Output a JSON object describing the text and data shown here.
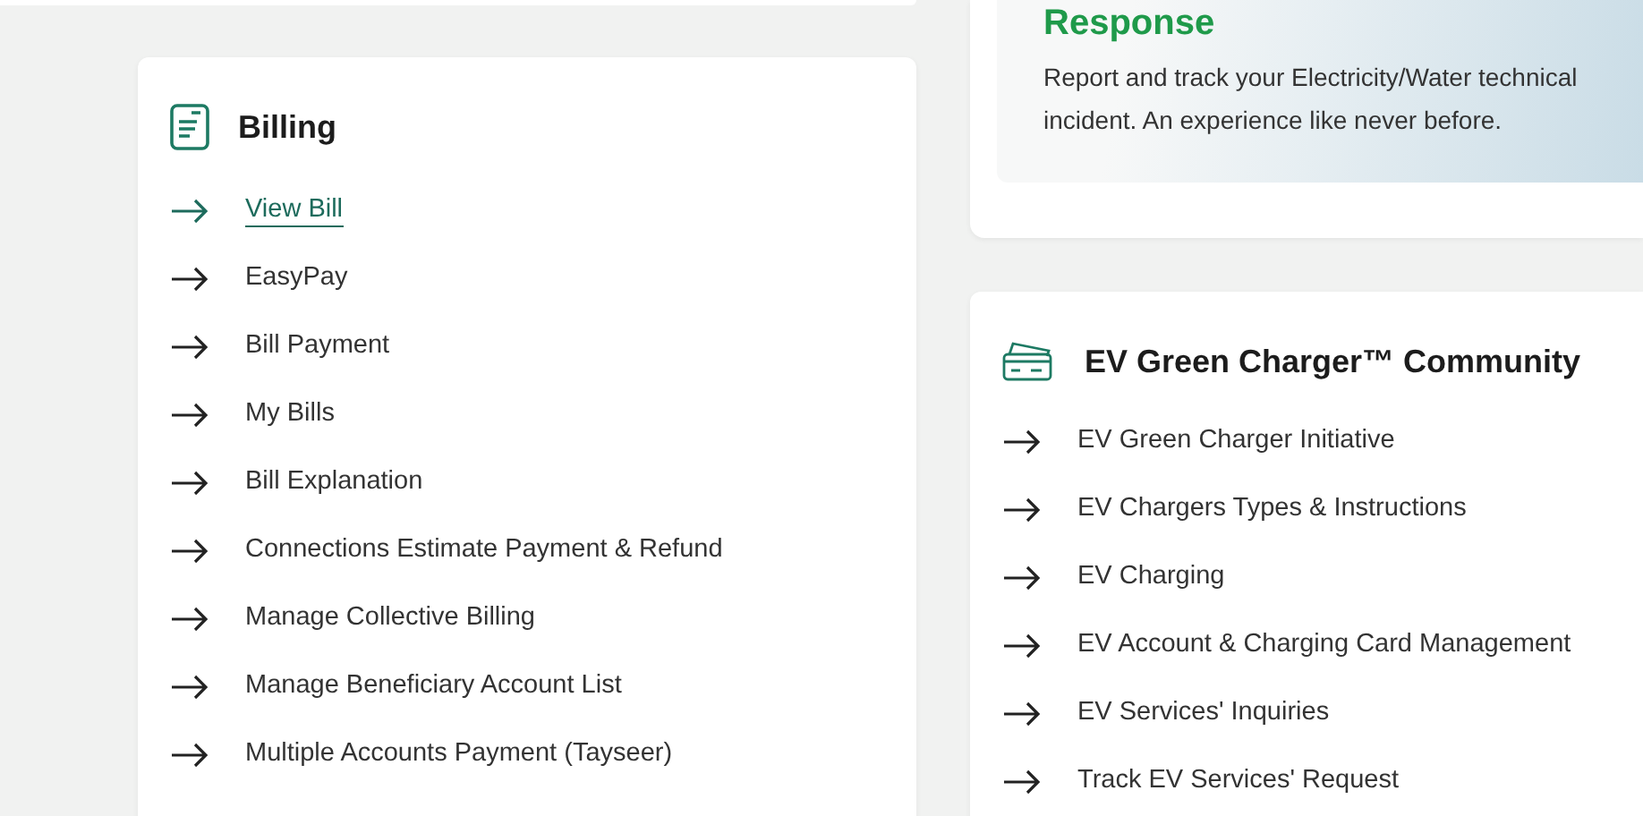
{
  "response_card": {
    "title": "Response",
    "description": "Report and track your Electricity/Water technical incident. An experience like never before."
  },
  "billing": {
    "title": "Billing",
    "links": [
      {
        "label": "View Bill",
        "selected": true
      },
      {
        "label": "EasyPay",
        "selected": false
      },
      {
        "label": "Bill Payment",
        "selected": false
      },
      {
        "label": "My Bills",
        "selected": false
      },
      {
        "label": "Bill Explanation",
        "selected": false
      },
      {
        "label": "Connections Estimate Payment & Refund",
        "selected": false
      },
      {
        "label": "Manage Collective Billing",
        "selected": false
      },
      {
        "label": "Manage Beneficiary Account List",
        "selected": false
      },
      {
        "label": "Multiple Accounts Payment (Tayseer)",
        "selected": false
      }
    ]
  },
  "ev": {
    "title": "EV Green Charger™ Community",
    "links": [
      {
        "label": "EV Green Charger Initiative",
        "selected": false
      },
      {
        "label": "EV Chargers Types & Instructions",
        "selected": false
      },
      {
        "label": "EV Charging",
        "selected": false
      },
      {
        "label": "EV Account & Charging Card Management",
        "selected": false
      },
      {
        "label": "EV Services' Inquiries",
        "selected": false
      },
      {
        "label": "Track EV Services' Request",
        "selected": false
      }
    ]
  }
}
